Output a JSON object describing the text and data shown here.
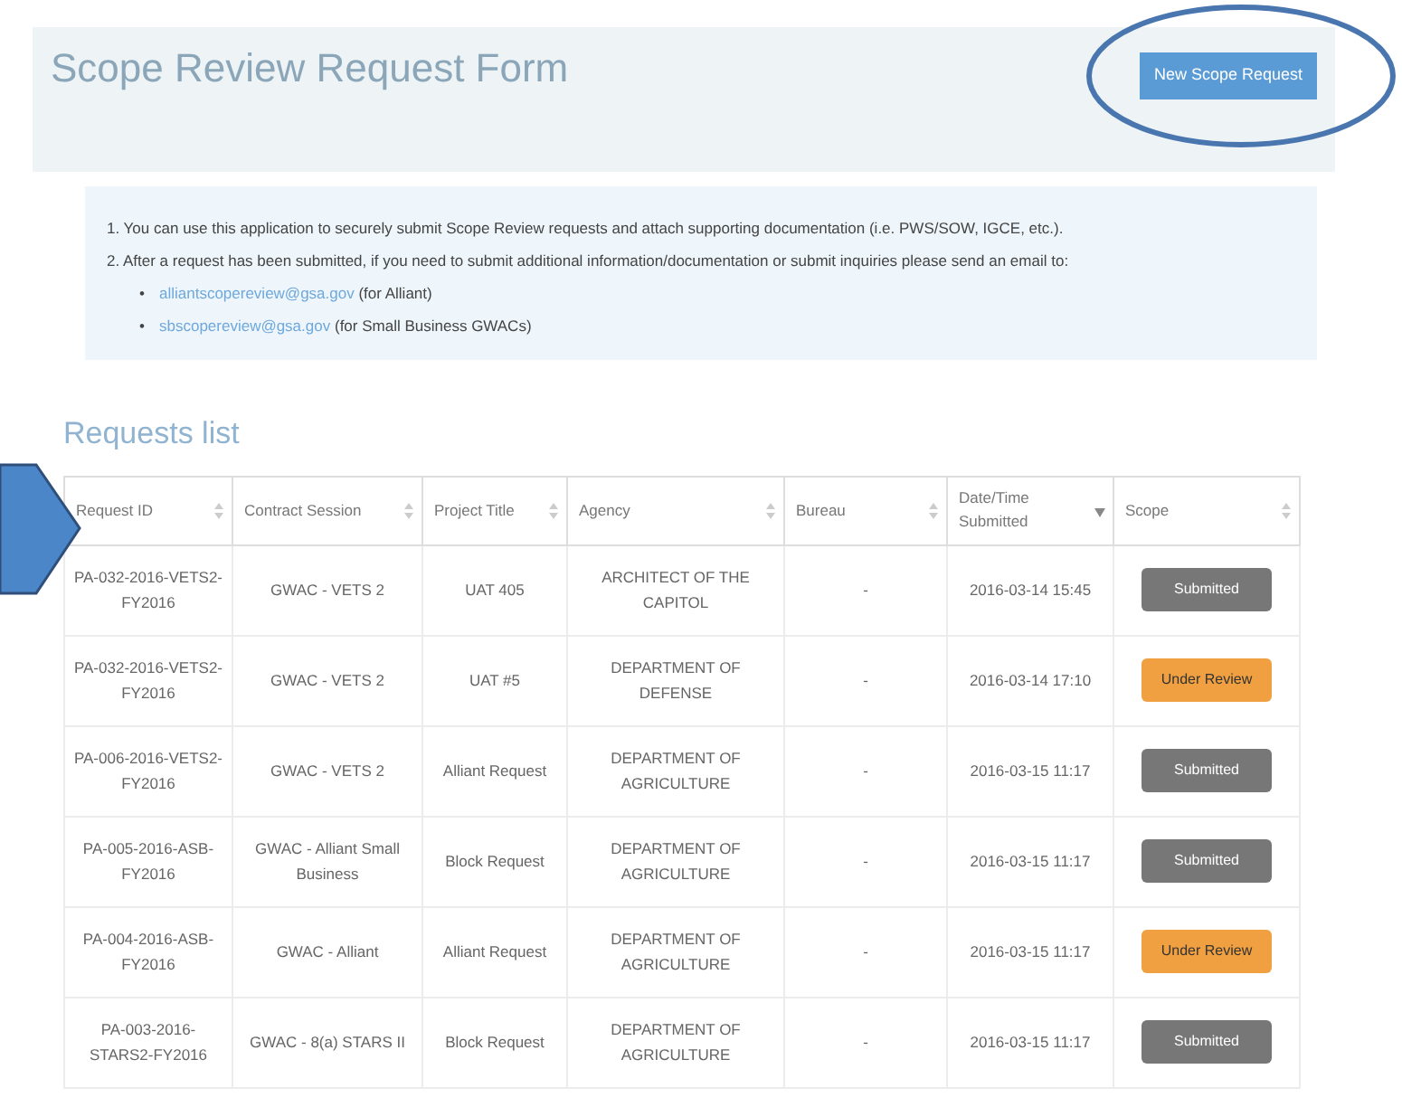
{
  "header": {
    "title": "Scope Review Request Form",
    "action_button": "New Scope Request"
  },
  "info": {
    "steps": [
      "1. You can use this application to securely submit Scope Review requests and attach supporting documentation (i.e. PWS/SOW, IGCE, etc.).",
      "2. After a request has been submitted, if you need to submit additional information/documentation or submit inquiries please send an email to:"
    ],
    "contacts": [
      {
        "marker": "•",
        "email": "alliantscopereview@gsa.gov",
        "note": "(for Alliant)"
      },
      {
        "marker": "•",
        "email": "sbscopereview@gsa.gov",
        "note": "(for Small Business GWACs)"
      }
    ]
  },
  "requests_list": {
    "title": "Requests list",
    "columns": [
      {
        "label": "Request ID",
        "sorted": false
      },
      {
        "label": "Contract Session",
        "sorted": false
      },
      {
        "label": "Project Title",
        "sorted": false
      },
      {
        "label": "Agency",
        "sorted": false
      },
      {
        "label": "Bureau",
        "sorted": false
      },
      {
        "label": "Date/Time Submitted",
        "sorted": true
      },
      {
        "label": "Scope",
        "sorted": false
      }
    ],
    "rows": [
      {
        "request_id": "PA-032-2016-VETS2-FY2016",
        "contract": "GWAC - VETS 2",
        "project": "UAT 405",
        "agency": "ARCHITECT OF THE CAPITOL",
        "bureau": "-",
        "submitted": "2016-03-14 15:45",
        "scope": "Submitted",
        "kind": "grey"
      },
      {
        "request_id": "PA-032-2016-VETS2-FY2016",
        "contract": "GWAC - VETS 2",
        "project": "UAT #5",
        "agency": "DEPARTMENT OF DEFENSE",
        "bureau": "-",
        "submitted": "2016-03-14 17:10",
        "scope": "Under Review",
        "kind": "orange"
      },
      {
        "request_id": "PA-006-2016-VETS2-FY2016",
        "contract": "GWAC - VETS 2",
        "project": "Alliant Request",
        "agency": "DEPARTMENT OF AGRICULTURE",
        "bureau": "-",
        "submitted": "2016-03-15 11:17",
        "scope": "Submitted",
        "kind": "grey"
      },
      {
        "request_id": "PA-005-2016-ASB-FY2016",
        "contract": "GWAC - Alliant Small Business",
        "project": "Block Request",
        "agency": "DEPARTMENT OF AGRICULTURE",
        "bureau": "-",
        "submitted": "2016-03-15 11:17",
        "scope": "Submitted",
        "kind": "grey"
      },
      {
        "request_id": "PA-004-2016-ASB-FY2016",
        "contract": "GWAC - Alliant",
        "project": "Alliant Request",
        "agency": "DEPARTMENT OF AGRICULTURE",
        "bureau": "-",
        "submitted": "2016-03-15 11:17",
        "scope": "Under Review",
        "kind": "orange"
      },
      {
        "request_id": "PA-003-2016-STARS2-FY2016",
        "contract": "GWAC - 8(a) STARS II",
        "project": "Block Request",
        "agency": "DEPARTMENT OF AGRICULTURE",
        "bureau": "-",
        "submitted": "2016-03-15 11:17",
        "scope": "Submitted",
        "kind": "grey"
      }
    ]
  },
  "annotations": {
    "highlight_ellipse": true,
    "pointer_arrow": true
  }
}
